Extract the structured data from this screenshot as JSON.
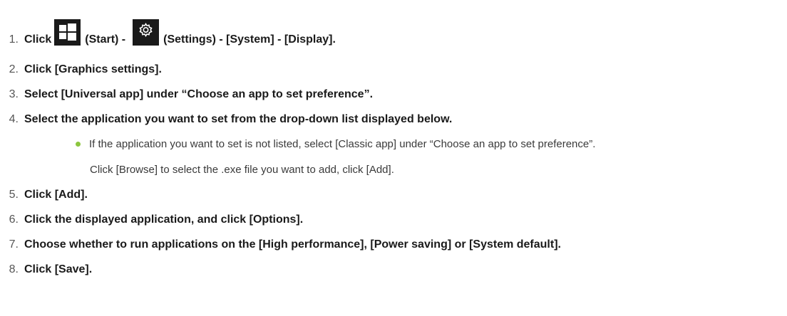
{
  "steps": [
    {
      "num": "1.",
      "parts": {
        "click": "Click",
        "start": "(Start) -",
        "settings": "(Settings) - [System] - [Display]."
      }
    },
    {
      "num": "2.",
      "text": "Click [Graphics settings]."
    },
    {
      "num": "3.",
      "text": "Select [Universal app] under “Choose an app to set preference”."
    },
    {
      "num": "4.",
      "text": "Select the application you want to set from the drop-down list displayed below."
    },
    {
      "num": "5.",
      "text": "Click [Add]."
    },
    {
      "num": "6.",
      "text": "Click the displayed application, and click [Options]."
    },
    {
      "num": "7.",
      "text": "Choose whether to run applications on the [High performance], [Power saving] or [System default]."
    },
    {
      "num": "8.",
      "text": "Click [Save]."
    }
  ],
  "note": {
    "line1": "If the application you want to set is not listed, select [Classic app] under “Choose an app to set preference”.",
    "line2": "Click [Browse] to select the .exe file you want to add, click [Add]."
  },
  "icons": {
    "start": "windows-start-icon",
    "settings": "gear-settings-icon"
  },
  "colors": {
    "bullet": "#8cc63f",
    "icon_bg": "#1a1a1a"
  }
}
